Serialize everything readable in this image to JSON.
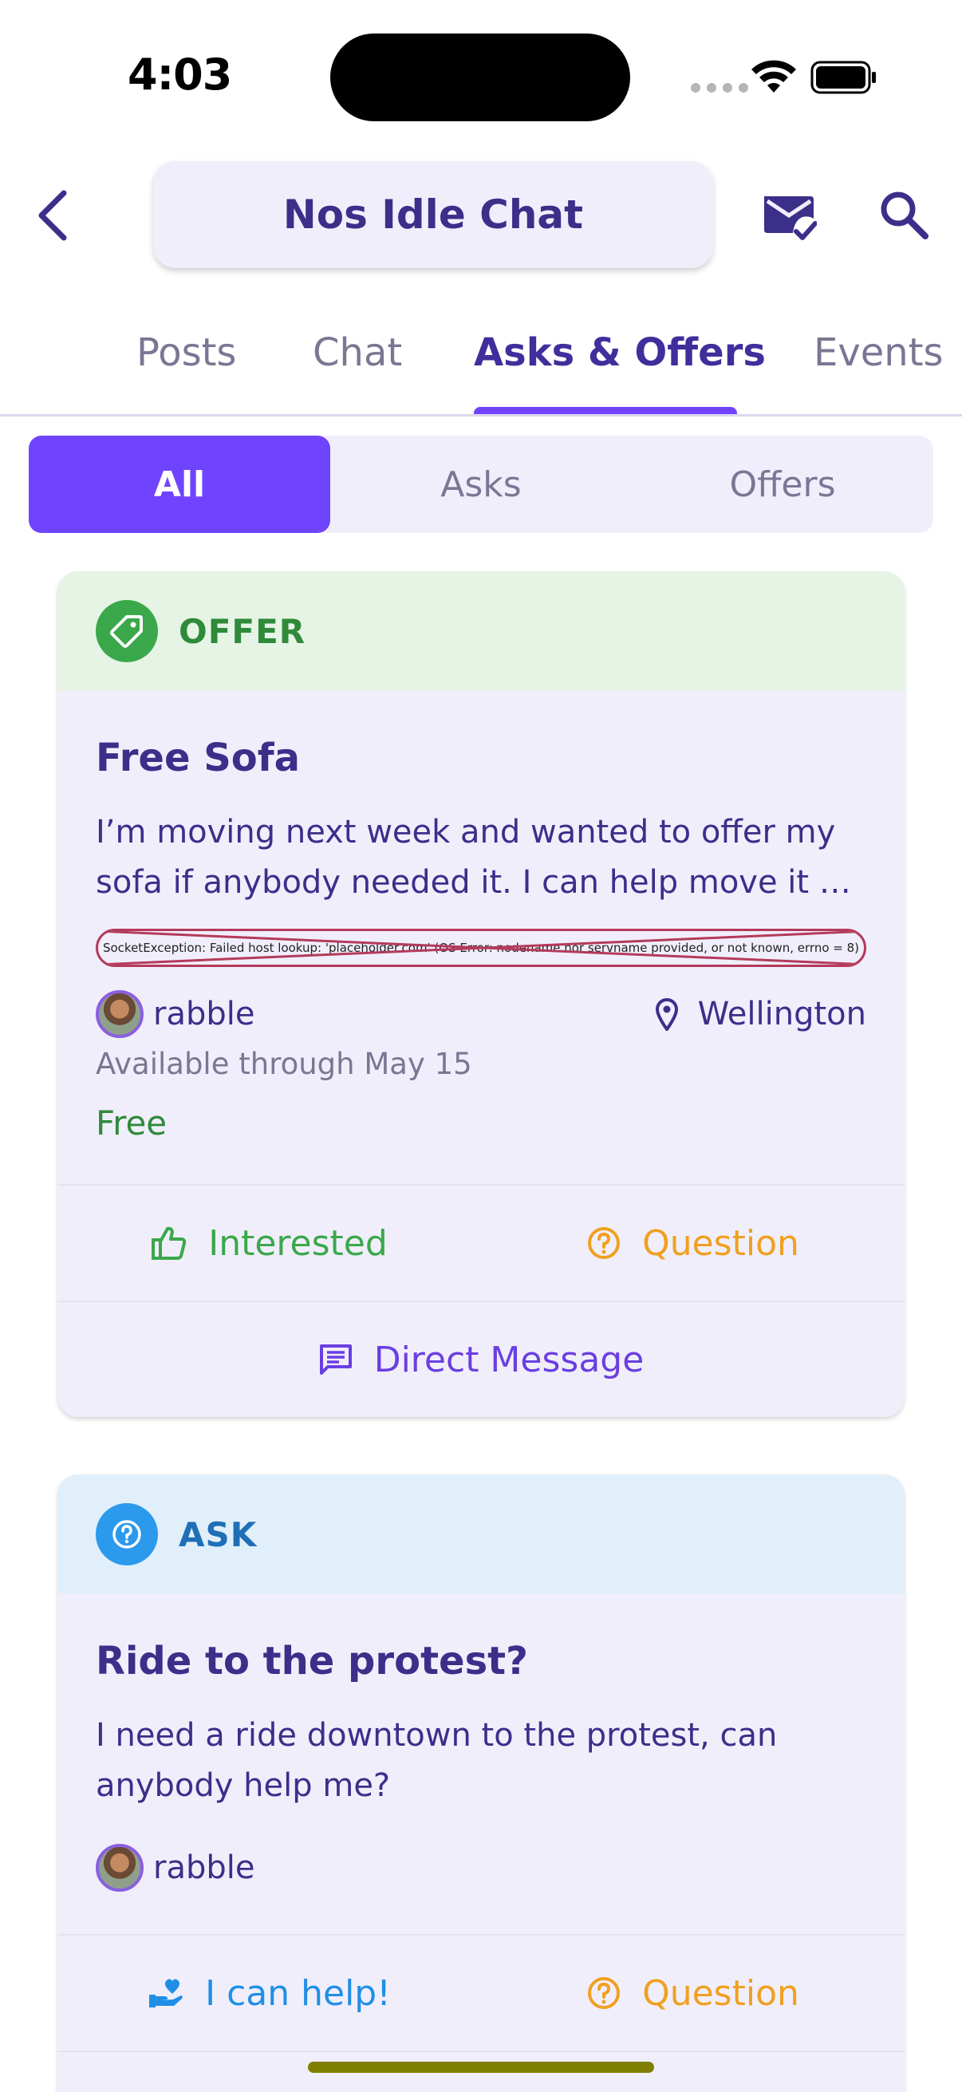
{
  "status_bar": {
    "time": "4:03"
  },
  "header": {
    "title": "Nos Idle Chat"
  },
  "tabs": [
    {
      "label": "Posts"
    },
    {
      "label": "Chat"
    },
    {
      "label": "Asks & Offers",
      "active": true
    },
    {
      "label": "Events"
    }
  ],
  "filter": {
    "options": [
      "All",
      "Asks",
      "Offers"
    ],
    "selected": "All"
  },
  "cards": [
    {
      "type_label": "OFFER",
      "icon": "tag-icon",
      "title": "Free Sofa",
      "description": "I’m moving next week and wanted to offer my sofa if anybody needed it. I can help move it …",
      "error_text": "SocketException: Failed host lookup: 'placeholder.com' (OS Error: nodename nor servname provided, or not known, errno = 8)",
      "author": "rabble",
      "location": "Wellington",
      "availability": "Available through May 15",
      "price": "Free",
      "actions": {
        "primary": "Interested",
        "secondary": "Question",
        "message": "Direct Message"
      }
    },
    {
      "type_label": "ASK",
      "icon": "question-icon",
      "title": "Ride to the protest?",
      "description": "I need a ride downtown to the protest, can anybody help me?",
      "author": "rabble",
      "actions": {
        "primary": "I can help!",
        "secondary": "Question"
      }
    }
  ],
  "colors": {
    "accent": "#7044ff",
    "primary_text": "#3b2f8a",
    "offer_green": "#3aa84a",
    "ask_blue": "#2b99ec",
    "question_orange": "#f0a020"
  }
}
